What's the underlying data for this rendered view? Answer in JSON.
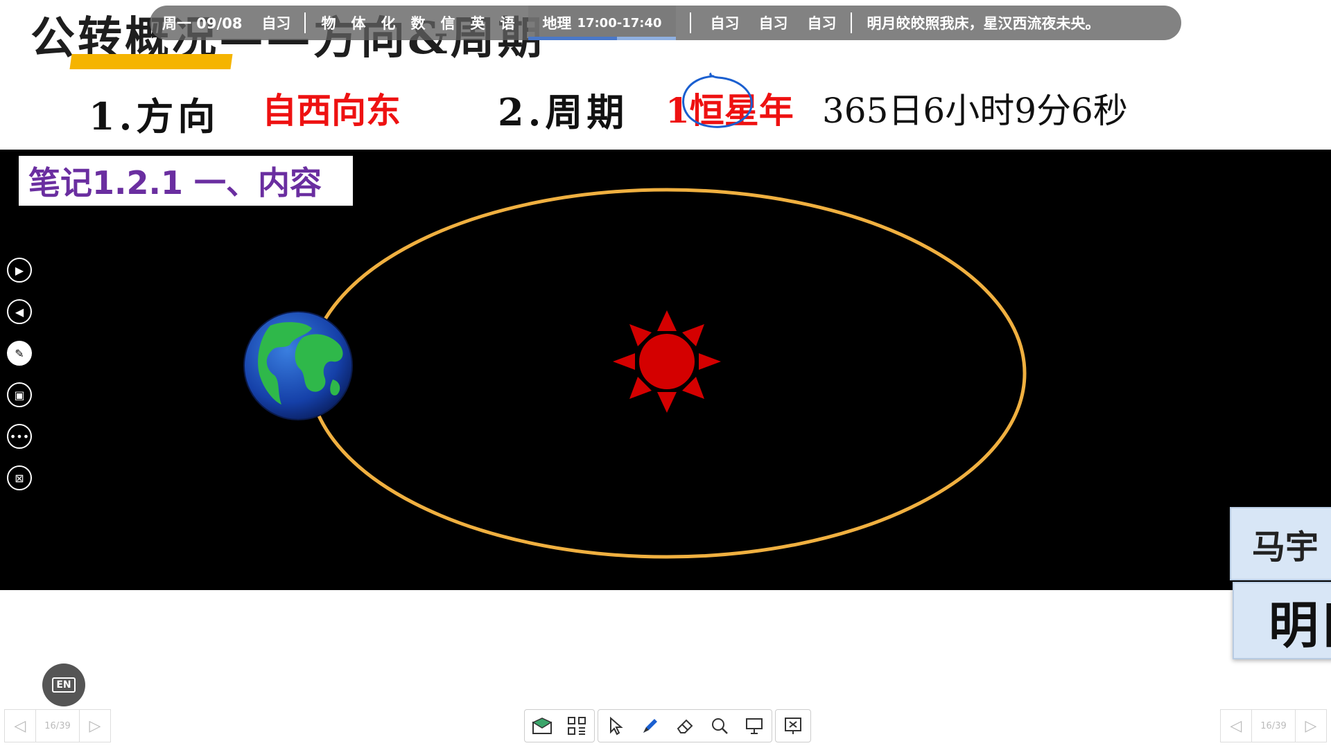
{
  "slide": {
    "title": "公转概况——方向&周期",
    "direction_label": "1.方向",
    "direction_value": "自西向东",
    "period_label": "2.周期",
    "period_value": "1恒星年",
    "period_time": "365日6小时9分6秒",
    "note_label": "笔记1.2.1 一、内容"
  },
  "schedule": {
    "day": "周一 09/08",
    "items": [
      "自习",
      "物",
      "体",
      "化",
      "数",
      "信",
      "英",
      "语"
    ],
    "active": {
      "subject": "地理",
      "time": "17:00-17:40",
      "progress": 0.6
    },
    "after": [
      "自习",
      "自习",
      "自习"
    ],
    "quote": "明月皎皎照我床，星汉西流夜未央。"
  },
  "name_card": {
    "line1": "马宇",
    "line2": "明日"
  },
  "en_button": "EN",
  "pager": {
    "left": "16/39",
    "right": "16/39"
  },
  "left_tools": [
    "play-next-icon",
    "play-prev-icon",
    "pen-off-icon",
    "whiteboard-icon",
    "more-icon",
    "end-show-icon"
  ],
  "bottom_tools": [
    "mail-icon",
    "apps-grid-icon",
    "pointer-icon",
    "pen-icon",
    "eraser-icon",
    "magnifier-icon",
    "screen-icon",
    "exit-show-icon"
  ],
  "colors": {
    "accent_red": "#ee1111",
    "note_purple": "#6a2ea0",
    "underline_yellow": "#f5b400",
    "orbit": "#f0b040",
    "sun": "#d40000",
    "ink_blue": "#1a5fd0"
  }
}
